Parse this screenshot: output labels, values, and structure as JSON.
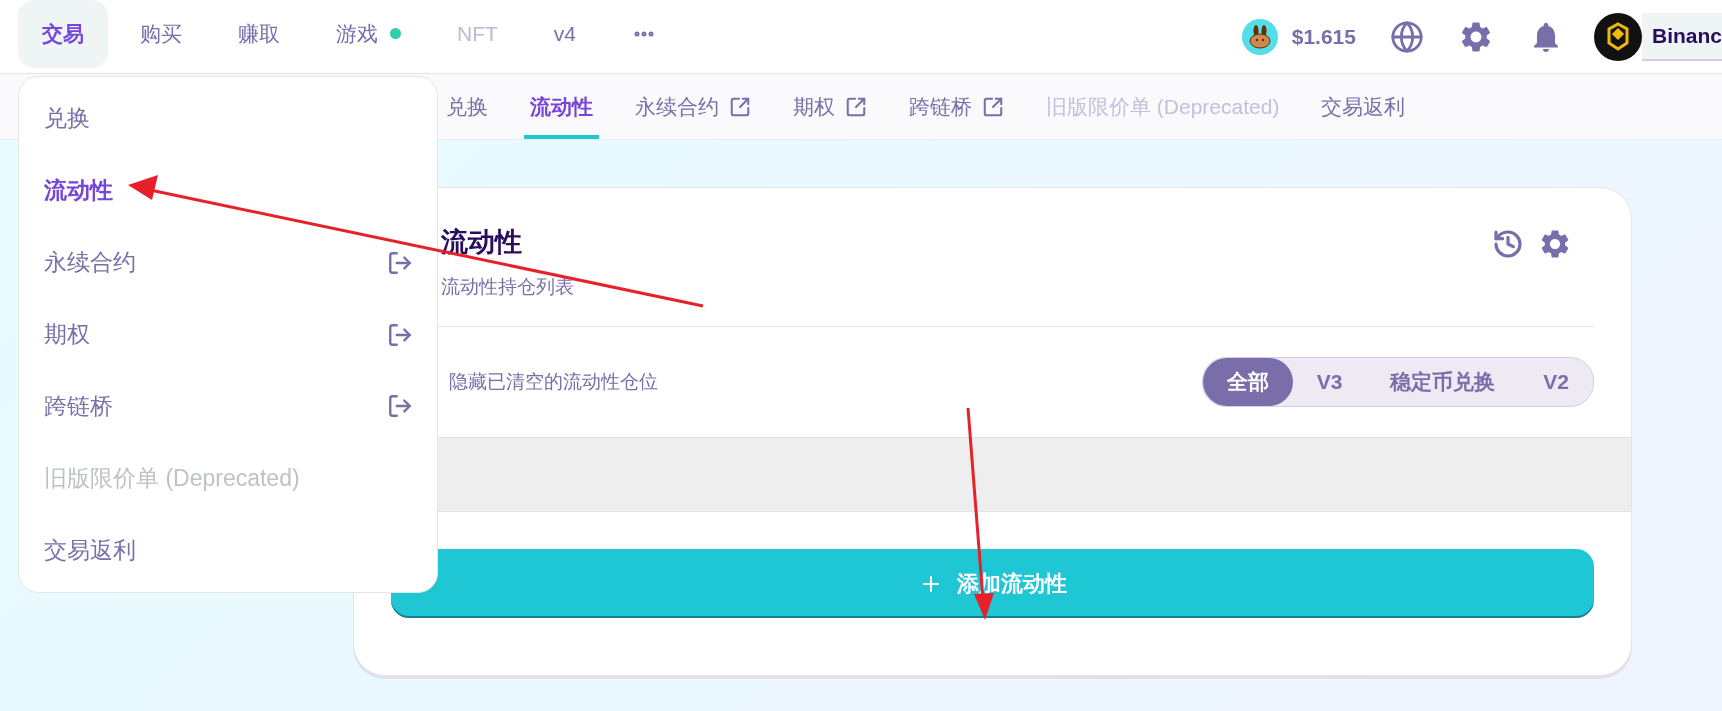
{
  "top_nav": {
    "items": [
      {
        "label": "交易",
        "selected": true,
        "disabled": false,
        "dot": false
      },
      {
        "label": "购买",
        "selected": false,
        "disabled": false,
        "dot": false
      },
      {
        "label": "赚取",
        "selected": false,
        "disabled": false,
        "dot": false
      },
      {
        "label": "游戏",
        "selected": false,
        "disabled": false,
        "dot": true
      },
      {
        "label": "NFT",
        "selected": false,
        "disabled": true,
        "dot": false
      },
      {
        "label": "v4",
        "selected": false,
        "disabled": false,
        "dot": false
      }
    ],
    "price": "$1.615",
    "account": "Binanc"
  },
  "sub_nav": {
    "items": [
      {
        "label": "兑换",
        "selected": false,
        "disabled": false,
        "external": false
      },
      {
        "label": "流动性",
        "selected": true,
        "disabled": false,
        "external": false
      },
      {
        "label": "永续合约",
        "selected": false,
        "disabled": false,
        "external": true
      },
      {
        "label": "期权",
        "selected": false,
        "disabled": false,
        "external": true
      },
      {
        "label": "跨链桥",
        "selected": false,
        "disabled": false,
        "external": true
      },
      {
        "label": "旧版限价单 (Deprecated)",
        "selected": false,
        "disabled": true,
        "external": false
      },
      {
        "label": "交易返利",
        "selected": false,
        "disabled": false,
        "external": false
      }
    ]
  },
  "dropdown": {
    "items": [
      {
        "label": "兑换",
        "selected": false,
        "disabled": false,
        "external": false
      },
      {
        "label": "流动性",
        "selected": true,
        "disabled": false,
        "external": false
      },
      {
        "label": "永续合约",
        "selected": false,
        "disabled": false,
        "external": true
      },
      {
        "label": "期权",
        "selected": false,
        "disabled": false,
        "external": true
      },
      {
        "label": "跨链桥",
        "selected": false,
        "disabled": false,
        "external": true
      },
      {
        "label": "旧版限价单 (Deprecated)",
        "selected": false,
        "disabled": true,
        "external": false
      },
      {
        "label": "交易返利",
        "selected": false,
        "disabled": false,
        "external": false
      }
    ]
  },
  "card": {
    "title": "流动性",
    "subtitle": "流动性持仓列表",
    "toggle_label": "隐藏已清空的流动性仓位",
    "filters": [
      {
        "label": "全部",
        "selected": true
      },
      {
        "label": "V3",
        "selected": false
      },
      {
        "label": "稳定币兑换",
        "selected": false
      },
      {
        "label": "V2",
        "selected": false
      }
    ],
    "add_button": "添加流动性"
  }
}
